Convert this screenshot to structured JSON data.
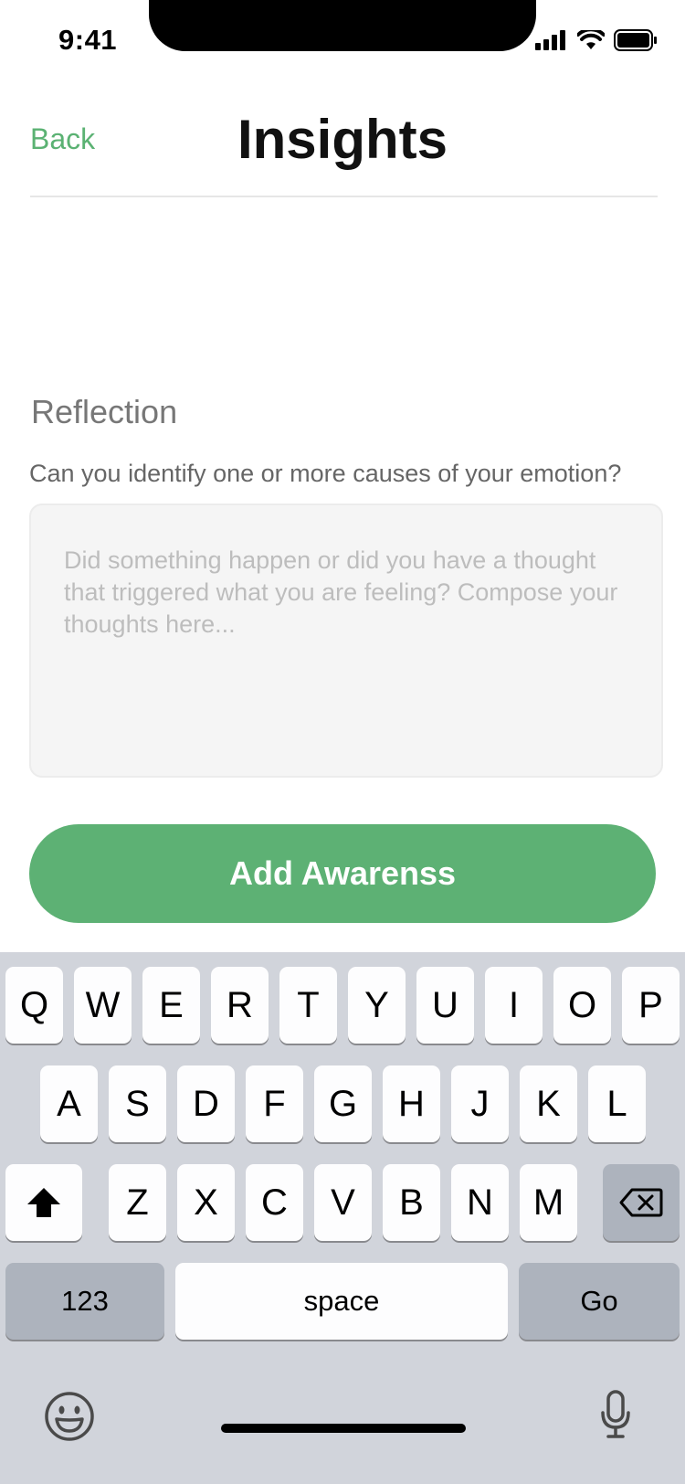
{
  "status": {
    "time": "9:41"
  },
  "header": {
    "back_label": "Back",
    "title": "Insights"
  },
  "reflection": {
    "section_title": "Reflection",
    "question": "Can you identify one or more causes of your emotion?",
    "placeholder": "Did something happen or did you have a thought that triggered what you are feeling? Compose your thoughts here..."
  },
  "cta": {
    "label": "Add Awarenss"
  },
  "keyboard": {
    "row1": [
      "Q",
      "W",
      "E",
      "R",
      "T",
      "Y",
      "U",
      "I",
      "O",
      "P"
    ],
    "row2": [
      "A",
      "S",
      "D",
      "F",
      "G",
      "H",
      "J",
      "K",
      "L"
    ],
    "row3": [
      "Z",
      "X",
      "C",
      "V",
      "B",
      "N",
      "M"
    ],
    "numbers_label": "123",
    "space_label": "space",
    "go_label": "Go",
    "icons": [
      "shift-icon",
      "backspace-icon",
      "emoji-icon",
      "microphone-icon"
    ]
  },
  "colors": {
    "accent": "#5db174",
    "keyboard_bg": "#d1d4db"
  }
}
